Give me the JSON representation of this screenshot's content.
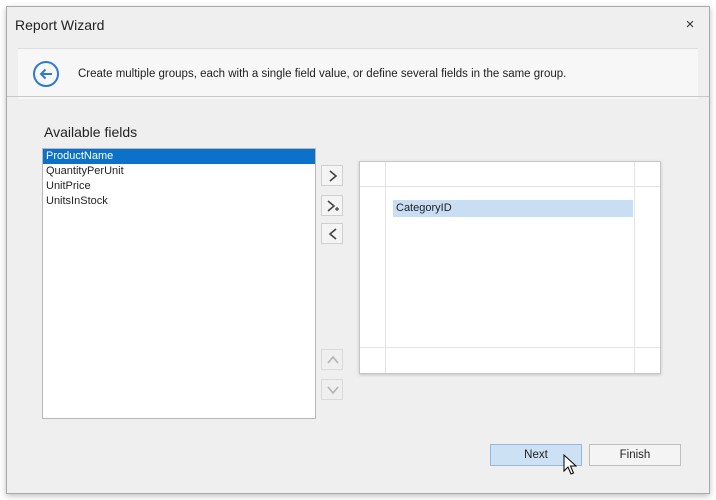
{
  "window": {
    "title": "Report Wizard",
    "close_glyph": "×"
  },
  "header": {
    "back_icon": "back-arrow-circle-icon",
    "description": "Create multiple groups, each with a single field value, or define several fields in the same group."
  },
  "available_fields": {
    "label": "Available fields",
    "items": [
      "ProductName",
      "QuantityPerUnit",
      "UnitPrice",
      "UnitsInStock"
    ],
    "selected_index": 0
  },
  "transfer_buttons": [
    "add-group-icon",
    "add-to-group-icon",
    "remove-group-icon"
  ],
  "order_buttons": [
    "move-up-icon",
    "move-down-icon"
  ],
  "groups": {
    "items": [
      "CategoryID"
    ]
  },
  "footer": {
    "next_label": "Next",
    "finish_label": "Finish"
  },
  "colors": {
    "accent": "#2d7bd1",
    "selection": "#0c71c9",
    "group_highlight": "#c9ddf3"
  }
}
